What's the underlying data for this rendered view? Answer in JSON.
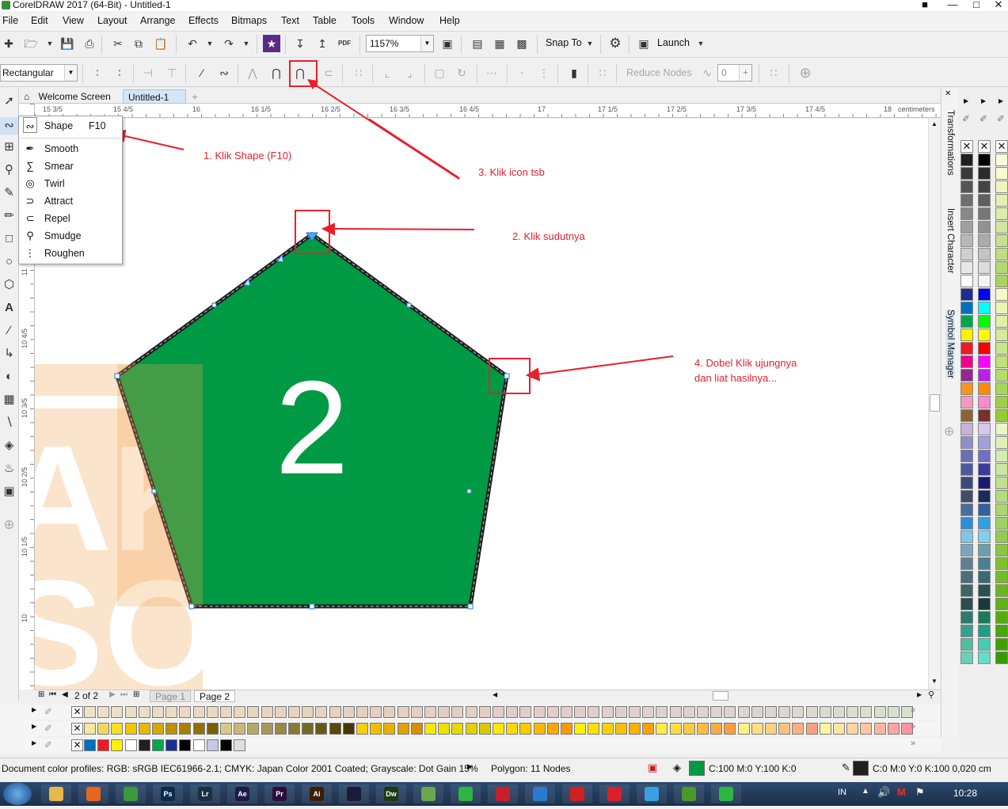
{
  "window": {
    "title": "CorelDRAW 2017 (64-Bit) - Untitled-1"
  },
  "menu": [
    "File",
    "Edit",
    "View",
    "Layout",
    "Arrange",
    "Effects",
    "Bitmaps",
    "Text",
    "Table",
    "Tools",
    "Window",
    "Help"
  ],
  "standard_toolbar": {
    "zoom_value": "1157%",
    "snap_label": "Snap To",
    "launch_label": "Launch"
  },
  "property_bar": {
    "selection_mode": "Rectangular",
    "reduce_nodes_label": "Reduce Nodes",
    "curve_smoothness": "0"
  },
  "tabs": {
    "welcome": "Welcome Screen",
    "document": "Untitled-1"
  },
  "ruler": {
    "unit": "centimeters",
    "h_labels": [
      "15 3/5",
      "15 4/5",
      "16",
      "16 1/5",
      "16 2/5",
      "16 3/5",
      "16 4/5",
      "17",
      "17 1/5",
      "17 2/5",
      "17 3/5",
      "17 4/5",
      "18"
    ],
    "v_labels": [
      "11",
      "10 4/5",
      "10 3/5",
      "10 2/5",
      "10 1/5",
      "10"
    ]
  },
  "flyout": {
    "items": [
      {
        "label": "Shape",
        "shortcut": "F10",
        "icon": "shape-tool-icon"
      },
      {
        "label": "Smooth",
        "icon": "smooth-tool-icon"
      },
      {
        "label": "Smear",
        "icon": "smear-tool-icon"
      },
      {
        "label": "Twirl",
        "icon": "twirl-tool-icon"
      },
      {
        "label": "Attract",
        "icon": "attract-tool-icon"
      },
      {
        "label": "Repel",
        "icon": "repel-tool-icon"
      },
      {
        "label": "Smudge",
        "icon": "smudge-tool-icon"
      },
      {
        "label": "Roughen",
        "icon": "roughen-tool-icon"
      }
    ]
  },
  "canvas": {
    "shape_fill": "#009a44",
    "shape_outline": "#1f1f1f",
    "shape_label": "2",
    "watermark_text_1": "AKT",
    "watermark_text_2": "SOT"
  },
  "annotations": {
    "a1": "1. Klik Shape (F10)",
    "a2": "2. Klik sudutnya",
    "a3": "3. Klik icon tsb",
    "a4_line1": "4. Dobel Klik ujungnya",
    "a4_line2": "dan liat hasilnya..."
  },
  "dockers": [
    "Transformations",
    "Insert Character",
    "Symbol Manager"
  ],
  "page_navigator": {
    "position": "2 of 2",
    "pages": [
      "Page 1",
      "Page 2"
    ]
  },
  "status": {
    "color_profiles": "Document color profiles: RGB: sRGB IEC61966-2.1; CMYK: Japan Color 2001 Coated; Grayscale: Dot Gain 15%",
    "object_info": "Polygon: 11 Nodes",
    "fill_info": "C:100 M:0 Y:100 K:0",
    "fill_color": "#009a44",
    "outline_info": "C:0 M:0 Y:0 K:100  0,020 cm",
    "outline_color": "#231f20"
  },
  "taskbar": {
    "language": "IN",
    "clock": "10:28",
    "apps": [
      {
        "name": "file-explorer-icon",
        "color": "#e8b84a",
        "label": ""
      },
      {
        "name": "firefox-icon",
        "color": "#e8651e",
        "label": ""
      },
      {
        "name": "chrome-icon",
        "color": "#3c9a3c",
        "label": ""
      },
      {
        "name": "photoshop-icon",
        "color": "#0c2a4a",
        "label": "Ps"
      },
      {
        "name": "lightroom-icon",
        "color": "#1a2f45",
        "label": "Lr"
      },
      {
        "name": "after-effects-icon",
        "color": "#1c1a4a",
        "label": "Ae"
      },
      {
        "name": "premiere-icon",
        "color": "#2a0f3a",
        "label": "Pr"
      },
      {
        "name": "illustrator-icon",
        "color": "#3a1f05",
        "label": "Ai"
      },
      {
        "name": "inkscape-icon",
        "color": "#1a1a3a",
        "label": ""
      },
      {
        "name": "dreamweaver-icon",
        "color": "#1f3a10",
        "label": "Dw"
      },
      {
        "name": "coreldraw-icon",
        "color": "#6aa84f",
        "label": ""
      },
      {
        "name": "whatsapp-icon",
        "color": "#2db742",
        "label": ""
      },
      {
        "name": "acrobat-icon",
        "color": "#c8202a",
        "label": ""
      },
      {
        "name": "network-icon",
        "color": "#2a7ad0",
        "label": ""
      },
      {
        "name": "record-icon",
        "color": "#d02020",
        "label": ""
      },
      {
        "name": "opera-icon",
        "color": "#d8202a",
        "label": ""
      },
      {
        "name": "messenger-icon",
        "color": "#3aa0e0",
        "label": ""
      },
      {
        "name": "app-green-icon",
        "color": "#4a9a2a",
        "label": ""
      },
      {
        "name": "whatsapp-2-icon",
        "color": "#2db742",
        "label": ""
      }
    ]
  }
}
